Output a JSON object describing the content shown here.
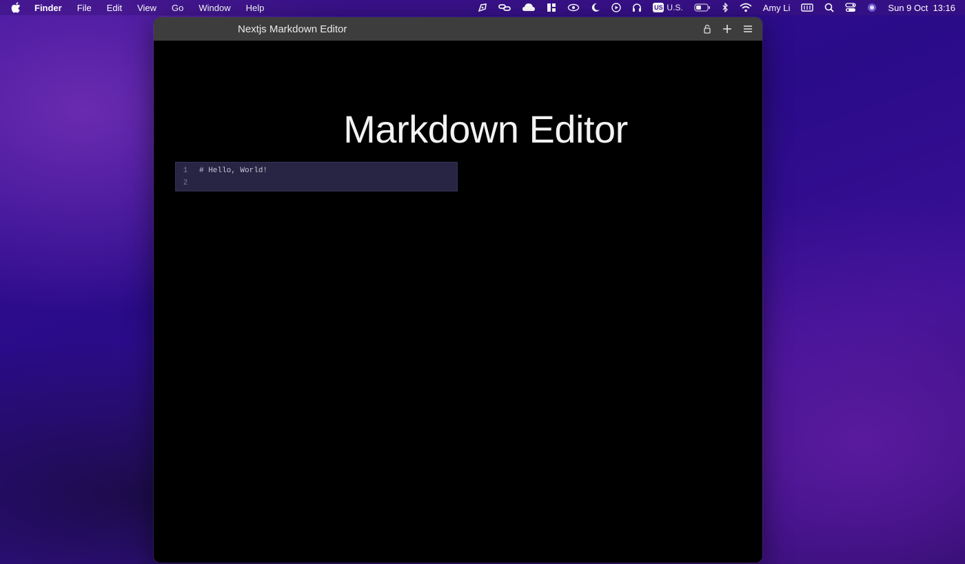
{
  "menubar": {
    "app_name": "Finder",
    "menus": [
      "File",
      "Edit",
      "View",
      "Go",
      "Window",
      "Help"
    ],
    "input_source_badge": "US",
    "input_source_label": "U.S.",
    "user_name": "Amy Li",
    "datetime": "Sun 9 Oct  13:16",
    "status_icons": [
      "pen-tool-icon",
      "link-icon",
      "cloud-icon",
      "layout-icon",
      "eye-icon",
      "moon-icon",
      "play-icon",
      "headphones-icon",
      "battery-icon",
      "bluetooth-icon",
      "wifi-icon",
      "keyboard-icon",
      "search-icon",
      "control-center-icon",
      "siri-icon"
    ]
  },
  "window": {
    "title": "Nextjs Markdown Editor",
    "toolbar_icons": [
      "lock-icon",
      "plus-icon",
      "menu-icon"
    ]
  },
  "page": {
    "heading": "Markdown Editor"
  },
  "editor": {
    "lines": [
      {
        "number": "1",
        "text": "# Hello, World!"
      },
      {
        "number": "2",
        "text": ""
      }
    ]
  }
}
